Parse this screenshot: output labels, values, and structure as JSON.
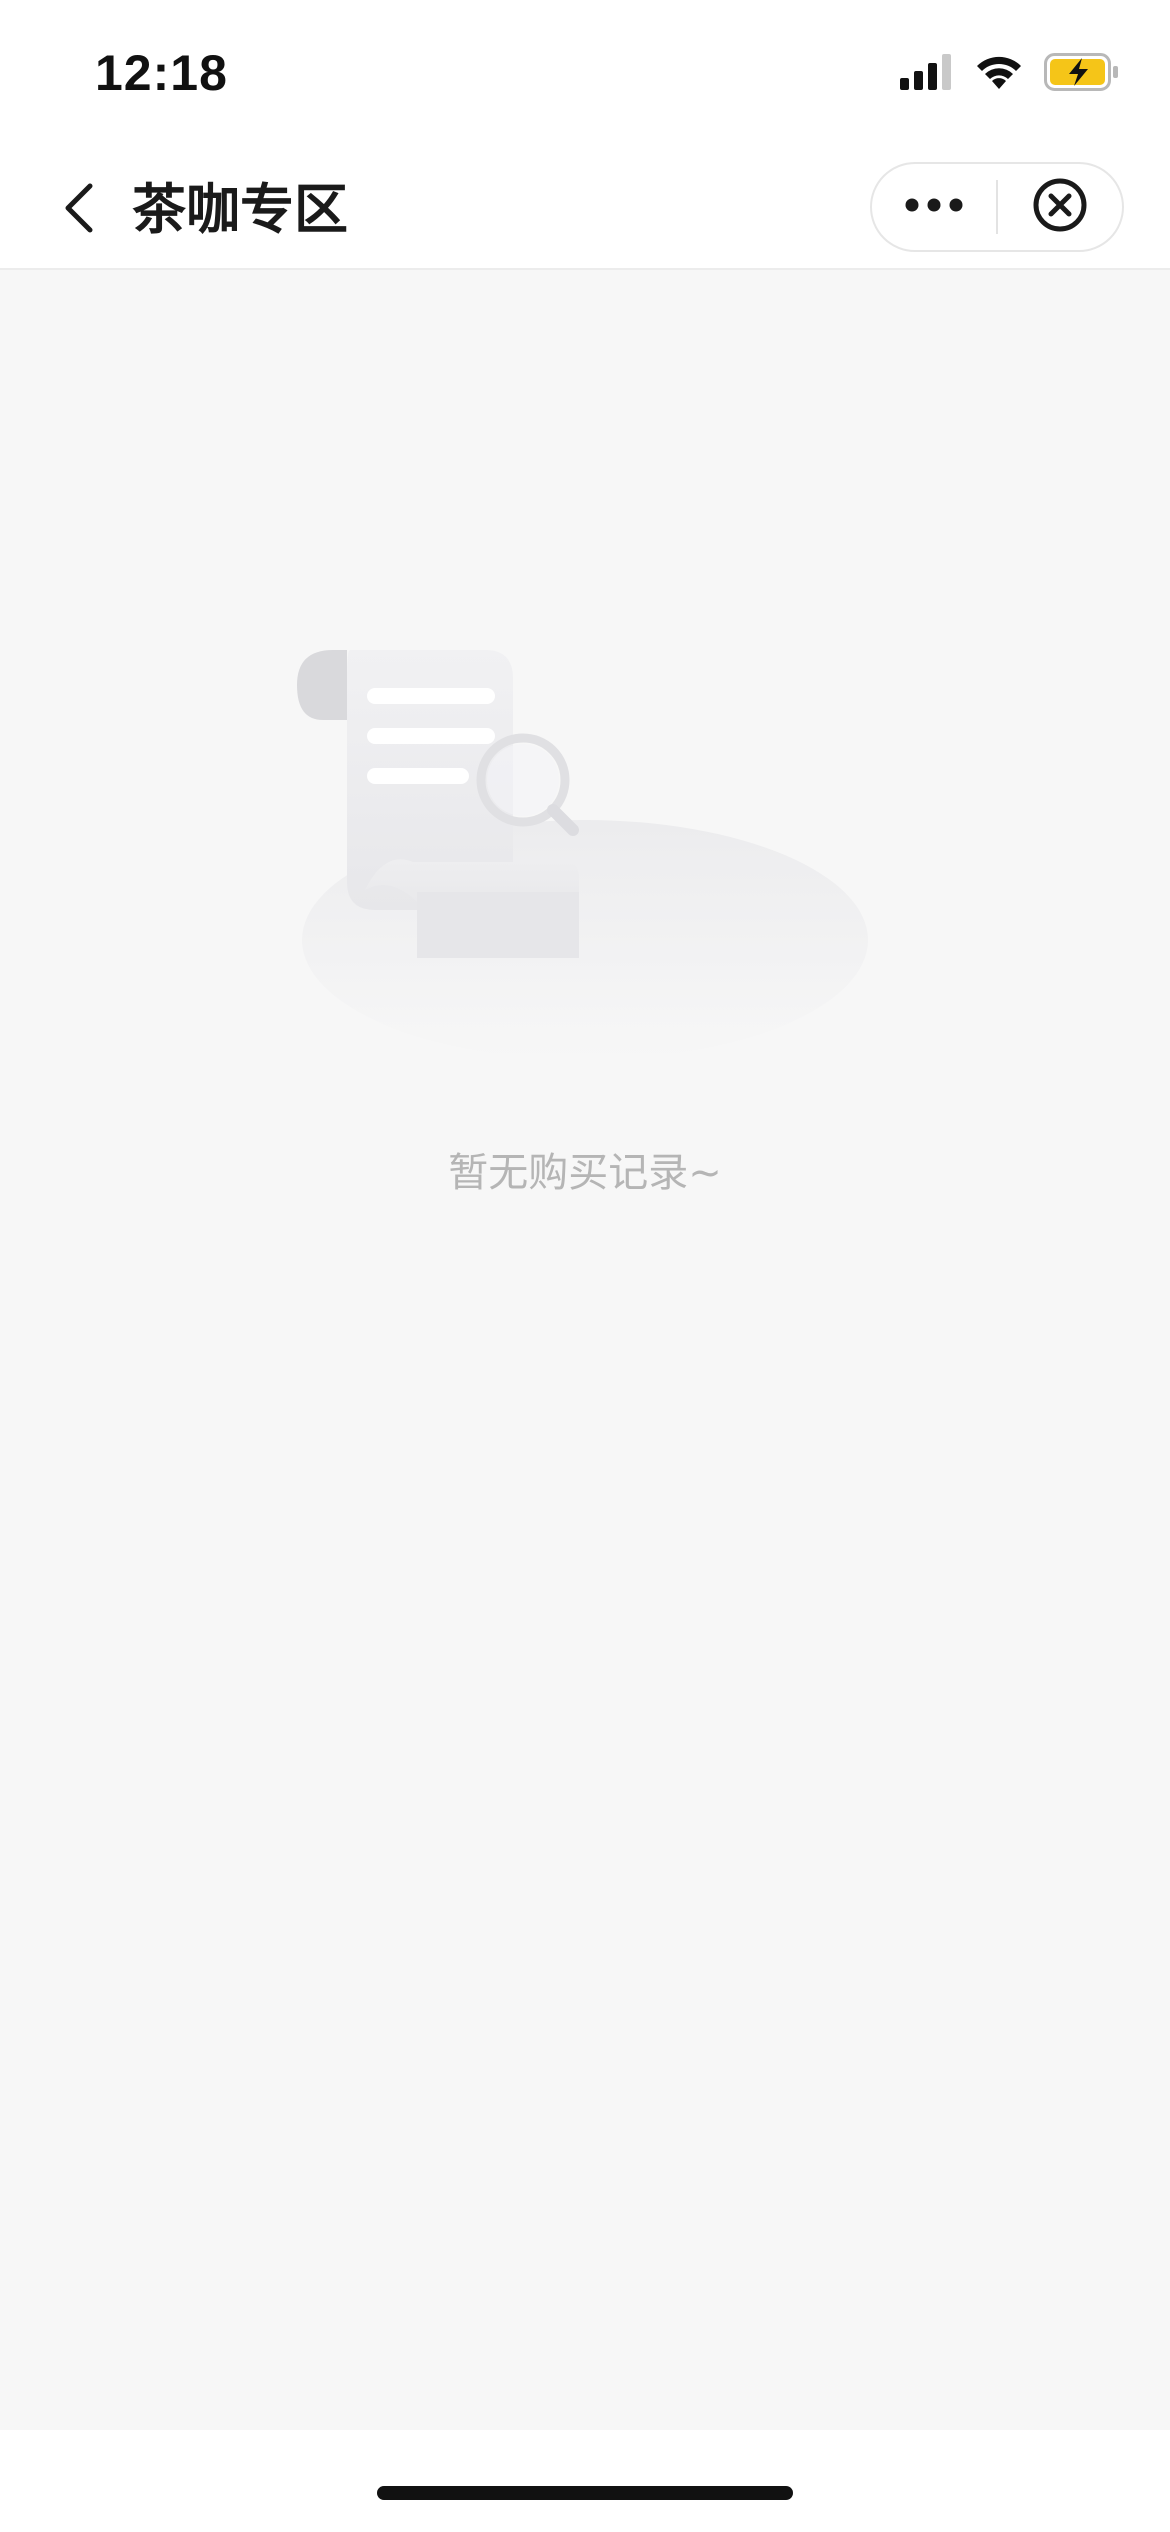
{
  "status_bar": {
    "time": "12:18",
    "icons": [
      "cellular-signal-icon",
      "wifi-icon",
      "battery-charging-icon"
    ],
    "battery_color": "#f5c518"
  },
  "nav": {
    "back_icon": "chevron-left-icon",
    "title": "茶咖专区",
    "more_icon": "more-dots-icon",
    "close_icon": "close-circle-icon"
  },
  "content": {
    "empty_illustration": "empty-receipt-search-illustration",
    "empty_text": "暂无购买记录~",
    "background_color": "#f7f7f7"
  }
}
